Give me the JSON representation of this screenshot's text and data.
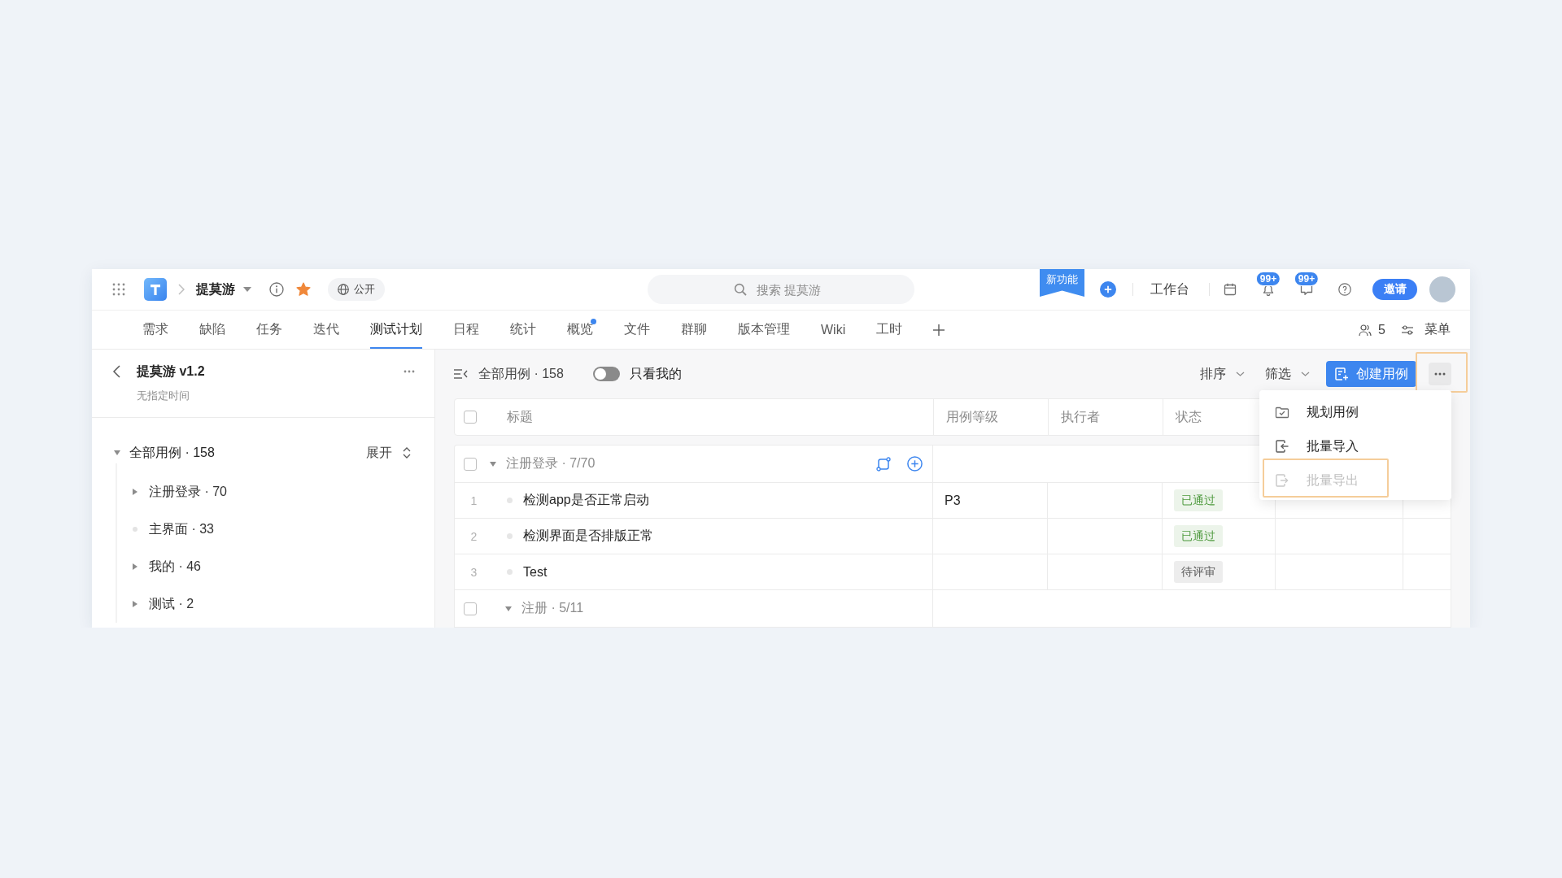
{
  "top_bar": {
    "project": {
      "name": "提莫游",
      "starred": true,
      "visibility": "公开"
    },
    "search": {
      "placeholder": "搜索 提莫游"
    },
    "new_feature": "新功能",
    "workbench": "工作台",
    "notifications": [
      {
        "kind": "bell",
        "count": "99+"
      },
      {
        "kind": "chat",
        "count": "99+"
      }
    ],
    "invite": "邀请"
  },
  "tabs": [
    {
      "label": "需求",
      "selected": false,
      "dot": false
    },
    {
      "label": "缺陷",
      "selected": false,
      "dot": false
    },
    {
      "label": "任务",
      "selected": false,
      "dot": false
    },
    {
      "label": "迭代",
      "selected": false,
      "dot": false
    },
    {
      "label": "测试计划",
      "selected": true,
      "dot": false
    },
    {
      "label": "日程",
      "selected": false,
      "dot": false
    },
    {
      "label": "统计",
      "selected": false,
      "dot": false
    },
    {
      "label": "概览",
      "selected": false,
      "dot": true
    },
    {
      "label": "文件",
      "selected": false,
      "dot": false
    },
    {
      "label": "群聊",
      "selected": false,
      "dot": false
    },
    {
      "label": "版本管理",
      "selected": false,
      "dot": false
    },
    {
      "label": "Wiki",
      "selected": false,
      "dot": false
    },
    {
      "label": "工时",
      "selected": false,
      "dot": false
    }
  ],
  "tab_tools": {
    "members": "5",
    "menu": "菜单"
  },
  "sidebar": {
    "title": "提莫游 v1.2",
    "subtitle": "无指定时间",
    "expand_label": "展开",
    "tree": [
      {
        "label": "全部用例 · 158",
        "kind": "folder",
        "expanded": true,
        "children": [
          {
            "label": "注册登录 · 70",
            "kind": "folder",
            "expanded": false
          },
          {
            "label": "主界面 · 33",
            "kind": "leaf"
          },
          {
            "label": "我的 · 46",
            "kind": "folder",
            "expanded": false
          },
          {
            "label": "测试 · 2",
            "kind": "folder",
            "expanded": false
          }
        ]
      }
    ]
  },
  "toolbar": {
    "scope": "全部用例 · 158",
    "only_mine": {
      "label": "只看我的",
      "on": false
    },
    "sort": "排序",
    "filter": "筛选",
    "create": "创建用例",
    "more": {
      "highlighted": true
    }
  },
  "more_menu": [
    {
      "label": "规划用例",
      "kind": "plan",
      "disabled": false,
      "highlighted": false
    },
    {
      "label": "批量导入",
      "kind": "import",
      "disabled": false,
      "highlighted": false
    },
    {
      "label": "批量导出",
      "kind": "export",
      "disabled": true,
      "highlighted": true
    }
  ],
  "table": {
    "select_all": {
      "checked": false
    },
    "columns": [
      "标题",
      "用例等级",
      "执行者",
      "状态"
    ],
    "groups": [
      {
        "title": "注册登录 · 7/70",
        "checked": false,
        "expanded": true,
        "hovered": true,
        "rows": [
          {
            "number": "1",
            "title": "检测app是否正常启动",
            "priority": "P3",
            "status": {
              "text": "已通过",
              "color": "#4e9a3e"
            }
          },
          {
            "number": "2",
            "title": "检测界面是否排版正常",
            "status": {
              "text": "已通过",
              "color": "#4e9a3e"
            }
          },
          {
            "number": "3",
            "title": "Test",
            "status": {
              "text": "待评审",
              "color": "#595959"
            }
          }
        ],
        "children": [
          {
            "title": "注册 · 5/11",
            "checked": false,
            "expanded": true,
            "hovered": false
          }
        ]
      }
    ]
  }
}
